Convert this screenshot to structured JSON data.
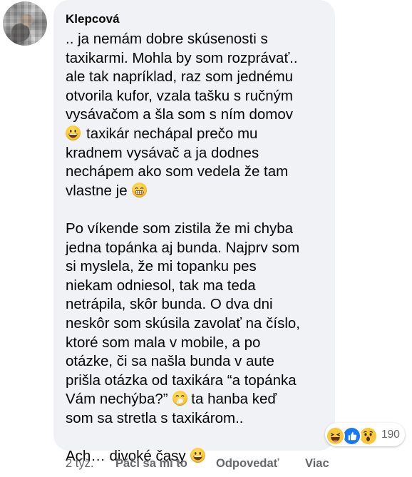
{
  "comment": {
    "author": "Klepcová",
    "lines": [
      {
        "text": ".. ja nemám dobre skúsenosti s"
      },
      {
        "text": "taxikarmi. Mohla by som rozprávať.."
      },
      {
        "text": "ale tak napríklad, raz som jednému"
      },
      {
        "text": "otvorila kufor, vzala tašku s ručným"
      },
      {
        "text": "vysávačom a šla som s ním domov"
      },
      {
        "text": "taxikár nechápal prečo mu",
        "emoji_before": "grinning-emoji"
      },
      {
        "text": "kradnem vysávač a ja dodnes"
      },
      {
        "text": "nechápem ako som vedela že tam"
      },
      {
        "text": "vlastne je",
        "emoji_after": "grimacing-emoji"
      },
      {
        "gap": true
      },
      {
        "text": "Po víkende som zistila že mi chyba"
      },
      {
        "text": "jedna topánka aj bunda. Najprv som"
      },
      {
        "text": "si myslela, že mi topanku pes"
      },
      {
        "text": "niekam odniesol, tak ma teda"
      },
      {
        "text": "netrápila, skôr bunda. O dva dni"
      },
      {
        "text": "neskôr som skúsila zavolať na číslo,"
      },
      {
        "text": "ktoré som mala v mobile, a po"
      },
      {
        "text": "otázke, či sa našla bunda v aute"
      },
      {
        "text": "prišla otázka od taxikára “a topánka"
      },
      {
        "text": "Vám nechýba?”",
        "emoji_after": "hand-over-mouth-emoji",
        "text_after": " ta hanba keď"
      },
      {
        "text": "som sa stretla s taxikárom.."
      },
      {
        "gap": true
      },
      {
        "text": "Ach… divoké časy",
        "emoji_after": "grinning-emoji"
      }
    ]
  },
  "reactions": {
    "icons": [
      "laughing-react-icon",
      "like-react-icon",
      "wow-react-icon"
    ],
    "count": "190"
  },
  "footer": {
    "time": "2 týž.",
    "like_label": "Páči sa mi to",
    "reply_label": "Odpovedať",
    "more_label": "Viac"
  },
  "colors": {
    "bubble": "#f0f2f5",
    "text": "#050505",
    "meta": "#65676b",
    "like_blue": "#1877f2",
    "emoji_yellow": "#fbc531"
  }
}
